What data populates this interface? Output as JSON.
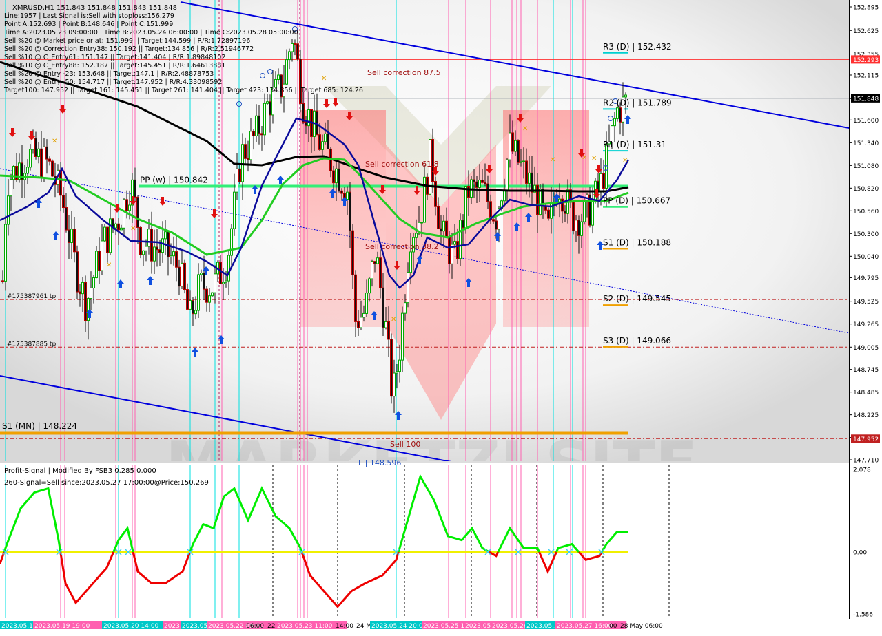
{
  "header": {
    "symbol_line": "XMRUSD,H1  151.843 151.848 151.843 151.848",
    "lines": [
      "Line:1957 | Last Signal is:Sell with stoploss:156.279",
      "Point A:152.693 | Point B:148.646 | Point C:151.999",
      "Time A:2023.05.23 09:00:00 | Time B:2023.05.24 06:00:00 | Time C:2023.05.28 05:00:00",
      "Sell %20 @ Market price or at: 151.999 || Target:144.599 | R/R:1.72897196",
      "Sell %20 @ Correction Entry38: 150.192 || Target:134.856 | R/R:2.51946772",
      "Sell %10 @ C_Entry61: 151.147 || Target:141.404 | R/R:1.89848102",
      "Sell %10 @ C_Entry88: 152.187 || Target:145.451 | R/R:1.64613881",
      "Sell %20 @ Entry -23: 153.648 || Target:147.1 | R/R:2.48878753",
      "Sell %20 @ Entry -50: 154.717 || Target:147.952 | R/R:4.33098592",
      "Target100: 147.952 || Target 161: 145.451 || Target 261: 141.404 || Target 423: 134.856 || Target 685: 124.26"
    ]
  },
  "price_axis": {
    "min": 147.7,
    "max": 152.9,
    "ticks": [
      152.895,
      152.625,
      152.355,
      152.115,
      151.845,
      151.6,
      151.34,
      151.08,
      150.82,
      150.56,
      150.3,
      150.04,
      149.795,
      149.525,
      149.265,
      149.0,
      148.745,
      148.485,
      148.225,
      147.965,
      147.71
    ],
    "tick_labels": [
      "152.895",
      "152.625",
      "152.355",
      "152.115",
      "151.845",
      "151.600",
      "151.340",
      "151.080",
      "150.820",
      "150.560",
      "150.300",
      "150.040",
      "149.795",
      "149.525",
      "149.265",
      "149.005",
      "148.745",
      "148.485",
      "148.225",
      "147.965",
      "147.710"
    ],
    "current_price": {
      "label": "151.848",
      "value": 151.848
    },
    "resistance_tag": {
      "label": "152.293",
      "value": 152.293,
      "color": "#ff3030"
    },
    "support_tag": {
      "label": "147.952",
      "value": 147.952,
      "color": "#c02020"
    }
  },
  "levels": {
    "pivots": [
      {
        "label": "R3 (D) | 152.432",
        "value": 152.432
      },
      {
        "label": "R2 (D) | 151.789",
        "value": 151.789
      },
      {
        "label": "R1 (D) | 151.31",
        "value": 151.31
      },
      {
        "label": "PP (D) | 150.667",
        "value": 150.667
      },
      {
        "label": "S1 (D) | 150.188",
        "value": 150.188
      },
      {
        "label": "S2 (D) | 149.545",
        "value": 149.545
      },
      {
        "label": "S3 (D) | 149.066",
        "value": 149.066
      }
    ],
    "weekly_pp": {
      "label": "PP (w) | 150.842",
      "value": 150.842
    },
    "monthly_s1": {
      "label": "S1 (MN) | 148.224",
      "value": 148.2
    },
    "tp_lines": [
      {
        "label": "#175387961 tp",
        "value": 149.545
      },
      {
        "label": "#175387885 tp",
        "value": 149.0
      }
    ],
    "annotations": [
      {
        "label": "Sell correction 87.5"
      },
      {
        "label": "Sell correction 61.8"
      },
      {
        "label": "Sell correction 38.2"
      },
      {
        "label": "Sell 100"
      },
      {
        "label": "L | 148.596"
      }
    ]
  },
  "oscillator": {
    "title": "Profit-Signal | Modified By FSB3 0.285 0.000",
    "signal": "260-Signal=Sell since:2023.05.27 17:00:00@Price:150.269",
    "ticks": [
      2.078,
      0.0,
      -1.586
    ],
    "tick_labels": [
      "2.078",
      "0.00",
      "-1.586"
    ],
    "colors": {
      "up": "#00ee00",
      "down": "#ee0000",
      "zero": "#f0f000"
    }
  },
  "time_axis": {
    "labels": [
      {
        "text": "2023.05.18 22:00",
        "hl": "#00c8c8"
      },
      {
        "text": "2023.05.19 19:00",
        "hl": "#ff60b0"
      },
      {
        "text": "2023.05.20 14:00",
        "hl": "#00c8c8"
      },
      {
        "text": "2023.05.20 20:00",
        "hl": "#ff60b0"
      },
      {
        "text": "2023.05.21 21:00",
        "hl": "#00c8c8"
      },
      {
        "text": "2023.05.22 09:00",
        "hl": "#ff60b0"
      },
      {
        "text": "06:00",
        "hl": ""
      },
      {
        "text": "22",
        "hl": ""
      },
      {
        "text": "2023.05.23 11:00",
        "hl": "#ff60b0"
      },
      {
        "text": "14:00",
        "hl": ""
      },
      {
        "text": "24 M",
        "hl": ""
      },
      {
        "text": "2023.05.24 20:00",
        "hl": "#00c8c8"
      },
      {
        "text": "2023.05.25 16:00",
        "hl": "#ff60b0"
      },
      {
        "text": "2023.05.26 01:00",
        "hl": "#ff60b0"
      },
      {
        "text": "2023.05.26 11:00",
        "hl": "#ff60b0"
      },
      {
        "text": "2023.05.27 08:00",
        "hl": "#00c8c8"
      },
      {
        "text": "2023.05.27 16:00",
        "hl": "#ff60b0"
      },
      {
        "text": "00",
        "hl": ""
      },
      {
        "text": "28 May 06:00",
        "hl": ""
      }
    ]
  },
  "watermark": {
    "text": "MARKETZI SITE"
  },
  "colors": {
    "background": "#ffffff",
    "up_candle": "#00aa00",
    "down_candle": "#bb0000",
    "ma_blue": "#0a0a9a",
    "ma_green": "#22cc22",
    "ma_black": "#000000",
    "channel": "#0000dd",
    "pp_week": "#33ee77",
    "pivot_line_orange": "#f0a000",
    "pivot_line_cyan": "#00d0d0",
    "cyan_vline": "#00e0e0",
    "pink_vline": "#ff60b0"
  }
}
